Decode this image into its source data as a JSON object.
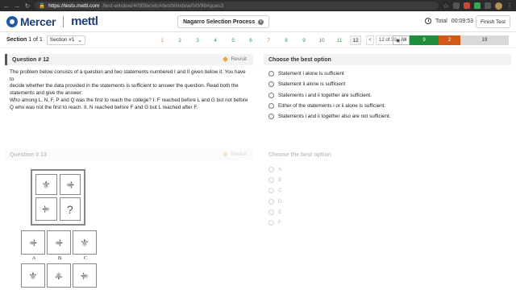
{
  "browser": {
    "url_host": "https://tests.mettl.com",
    "url_path": "/test-window/4095fecetc#/testWindow/0/0/98#ques3"
  },
  "header": {
    "brand_primary": "Mercer",
    "brand_secondary": "mettl",
    "test_title": "Nagarro Selection Process",
    "total_label": "Total",
    "total_time": "00:09:53",
    "finish_label": "Finish Test"
  },
  "section_bar": {
    "section_label": "Section",
    "section_position": "1 of 1",
    "section_select": "Section #1",
    "questions": [
      {
        "n": "1",
        "state": "answered-orange"
      },
      {
        "n": "2",
        "state": "answered"
      },
      {
        "n": "3",
        "state": "answered"
      },
      {
        "n": "4",
        "state": "answered"
      },
      {
        "n": "5",
        "state": "answered"
      },
      {
        "n": "6",
        "state": "answered"
      },
      {
        "n": "7",
        "state": "answered-orange"
      },
      {
        "n": "8",
        "state": "answered"
      },
      {
        "n": "9",
        "state": "answered"
      },
      {
        "n": "10",
        "state": "answered"
      },
      {
        "n": "11",
        "state": "answered"
      },
      {
        "n": "12",
        "state": "current"
      }
    ],
    "pager_prev": "<",
    "pager_count": "12 of 30",
    "pager_next": ">",
    "all_label": "All",
    "answered_count": "9",
    "review_count": "2",
    "unanswered_count": "19",
    "colors": {
      "answered": "#1f8d3d",
      "review": "#d15b16",
      "unanswered": "#d9d9d9"
    }
  },
  "question12": {
    "title": "Question # 12",
    "revisit_label": "Revisit",
    "text_lines": [
      "The problem below consists of a question and two statements numbered I and II given below it. You have to",
      "decide whether the data provided in the statements is sufficient to answer the question. Read both the",
      "statements and give the answer:",
      "Who among L, N, F, P and Q was the first to reach the college? I. F reached before L and G but not before",
      "Q who was not the first to reach. II. N reached before F and G but L reached after F."
    ],
    "options_heading": "Choose the best option",
    "options": [
      "Statement i alone is sufficient",
      "Statement ii alone is sufficient",
      "Statements i and ii together are sufficient.",
      "Either of the statements i or ii alone is sufficient.",
      "Statements i and ii together also are not sufficient."
    ]
  },
  "question13": {
    "title": "Question # 13",
    "revisit_label": "Revisit",
    "options_heading": "Choose the best option",
    "options": [
      "A",
      "B",
      "C",
      "D",
      "E",
      "F"
    ],
    "missing_mark": "?",
    "answer_labels": [
      "A",
      "B",
      "C"
    ]
  }
}
